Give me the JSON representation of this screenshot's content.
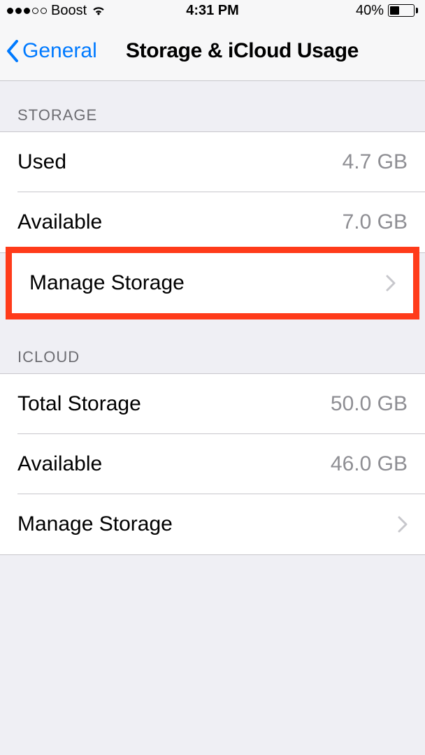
{
  "status_bar": {
    "carrier": "Boost",
    "time": "4:31 PM",
    "battery_percent": "40%",
    "battery_fill_width": "40%"
  },
  "nav": {
    "back_label": "General",
    "title": "Storage & iCloud Usage"
  },
  "sections": {
    "storage": {
      "header": "STORAGE",
      "used": {
        "label": "Used",
        "value": "4.7 GB"
      },
      "available": {
        "label": "Available",
        "value": "7.0 GB"
      },
      "manage": {
        "label": "Manage Storage"
      }
    },
    "icloud": {
      "header": "ICLOUD",
      "total": {
        "label": "Total Storage",
        "value": "50.0 GB"
      },
      "available": {
        "label": "Available",
        "value": "46.0 GB"
      },
      "manage": {
        "label": "Manage Storage"
      }
    }
  }
}
